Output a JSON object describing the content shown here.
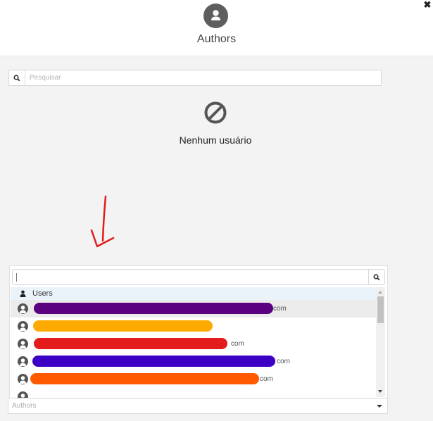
{
  "header": {
    "title": "Authors",
    "icon": "user-icon",
    "close_icon": "close-icon",
    "close_glyph": "✖"
  },
  "search": {
    "placeholder": "Pesquisar",
    "value": "",
    "icon": "search-icon"
  },
  "empty_state": {
    "icon": "no-entry-icon",
    "message": "Nenhum usuário"
  },
  "annotation": {
    "type": "hand-drawn-arrow",
    "color": "#e11d1d",
    "direction": "down-left"
  },
  "dropdown": {
    "search_value": "",
    "search_icon": "search-icon",
    "group_label": "Users",
    "group_icon": "user-icon",
    "rows": [
      {
        "suffix": ".com",
        "redaction_color": "#5b0080",
        "active": true
      },
      {
        "suffix": "",
        "redaction_color": "#ffaa00",
        "active": false
      },
      {
        "suffix": ".com",
        "redaction_color": "#e31b1b",
        "active": false
      },
      {
        "suffix": ".com",
        "redaction_color": "#3b00c4",
        "active": false
      },
      {
        "suffix": ".com",
        "redaction_color": "#ff5a00",
        "active": false
      }
    ]
  },
  "select": {
    "placeholder": "Authors",
    "icon": "caret-down-icon"
  }
}
